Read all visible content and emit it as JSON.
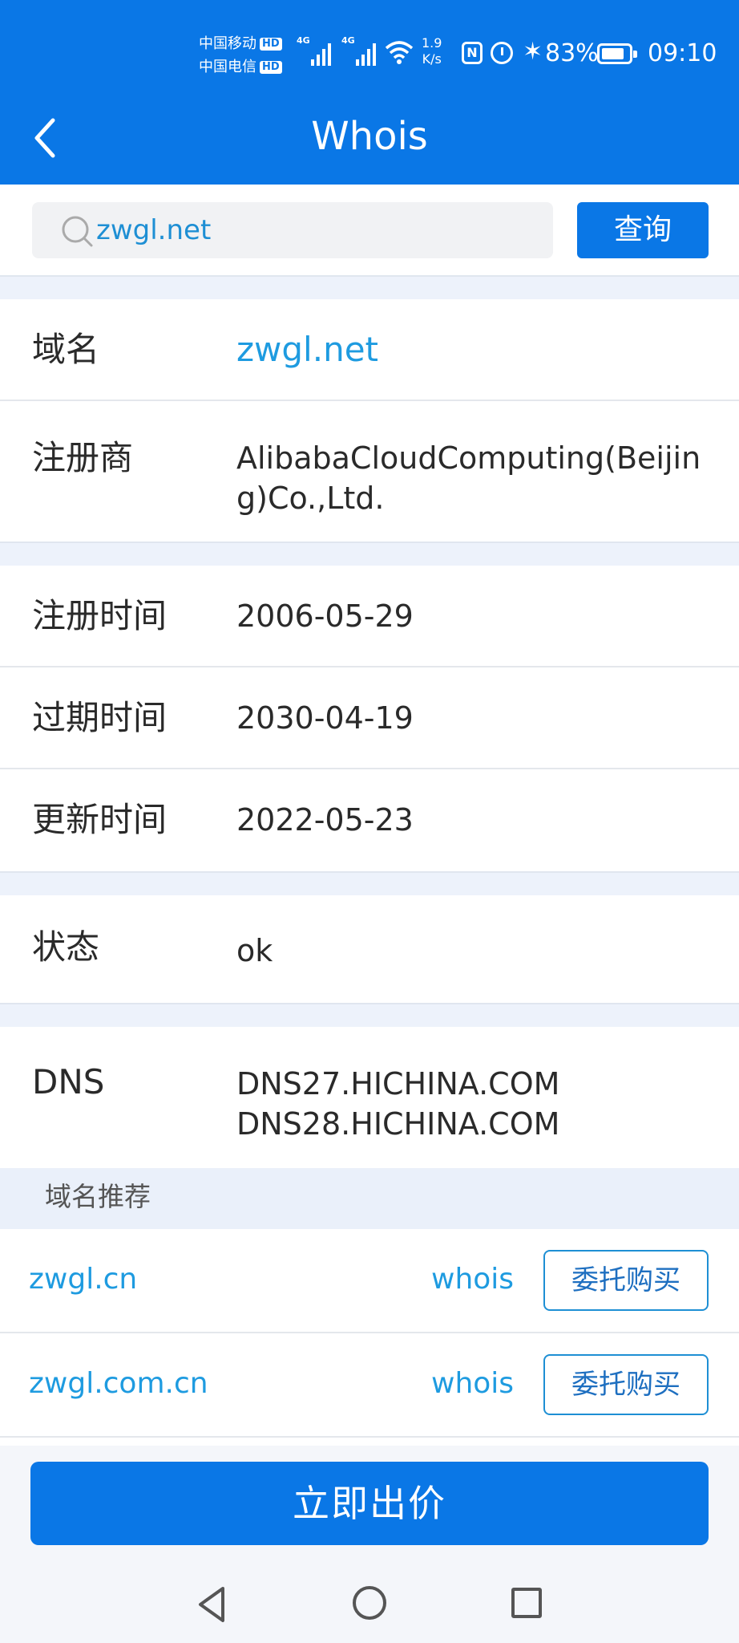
{
  "status_bar": {
    "carrier1": "中国移动",
    "carrier2": "中国电信",
    "hd": "HD",
    "network1": "4G",
    "network2": "4G",
    "speed_value": "1.9",
    "speed_unit": "K/s",
    "nfc": "N",
    "battery": "83%",
    "battery_level": 0.83,
    "time": "09:10"
  },
  "header": {
    "title": "Whois"
  },
  "search": {
    "value": "zwgl.net",
    "button_label": "查询"
  },
  "info": {
    "domain_label": "域名",
    "domain_value": "zwgl.net",
    "registrar_label": "注册商",
    "registrar_value": "AlibabaCloudComputing(Beijing)Co.,Ltd.",
    "reg_time_label": "注册时间",
    "reg_time_value": "2006-05-29",
    "expire_label": "过期时间",
    "expire_value": "2030-04-19",
    "update_label": "更新时间",
    "update_value": "2022-05-23",
    "status_label": "状态",
    "status_value": "ok",
    "dns_label": "DNS",
    "dns_values": [
      "DNS27.HICHINA.COM",
      "DNS28.HICHINA.COM"
    ]
  },
  "recommend": {
    "title": "域名推荐",
    "items": [
      {
        "domain": "zwgl.cn",
        "whois": "whois",
        "buy": "委托购买"
      },
      {
        "domain": "zwgl.com.cn",
        "whois": "whois",
        "buy": "委托购买"
      }
    ]
  },
  "footer": {
    "bid_label": "立即出价"
  },
  "colors": {
    "primary": "#0a77e6",
    "link": "#1e9be0",
    "gap": "#edf2fb"
  }
}
